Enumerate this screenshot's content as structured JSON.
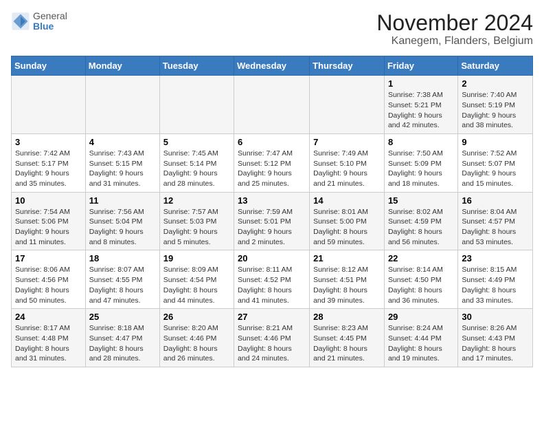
{
  "logo": {
    "general": "General",
    "blue": "Blue"
  },
  "title": "November 2024",
  "subtitle": "Kanegem, Flanders, Belgium",
  "weekdays": [
    "Sunday",
    "Monday",
    "Tuesday",
    "Wednesday",
    "Thursday",
    "Friday",
    "Saturday"
  ],
  "weeks": [
    [
      {
        "day": "",
        "info": ""
      },
      {
        "day": "",
        "info": ""
      },
      {
        "day": "",
        "info": ""
      },
      {
        "day": "",
        "info": ""
      },
      {
        "day": "",
        "info": ""
      },
      {
        "day": "1",
        "info": "Sunrise: 7:38 AM\nSunset: 5:21 PM\nDaylight: 9 hours and 42 minutes."
      },
      {
        "day": "2",
        "info": "Sunrise: 7:40 AM\nSunset: 5:19 PM\nDaylight: 9 hours and 38 minutes."
      }
    ],
    [
      {
        "day": "3",
        "info": "Sunrise: 7:42 AM\nSunset: 5:17 PM\nDaylight: 9 hours and 35 minutes."
      },
      {
        "day": "4",
        "info": "Sunrise: 7:43 AM\nSunset: 5:15 PM\nDaylight: 9 hours and 31 minutes."
      },
      {
        "day": "5",
        "info": "Sunrise: 7:45 AM\nSunset: 5:14 PM\nDaylight: 9 hours and 28 minutes."
      },
      {
        "day": "6",
        "info": "Sunrise: 7:47 AM\nSunset: 5:12 PM\nDaylight: 9 hours and 25 minutes."
      },
      {
        "day": "7",
        "info": "Sunrise: 7:49 AM\nSunset: 5:10 PM\nDaylight: 9 hours and 21 minutes."
      },
      {
        "day": "8",
        "info": "Sunrise: 7:50 AM\nSunset: 5:09 PM\nDaylight: 9 hours and 18 minutes."
      },
      {
        "day": "9",
        "info": "Sunrise: 7:52 AM\nSunset: 5:07 PM\nDaylight: 9 hours and 15 minutes."
      }
    ],
    [
      {
        "day": "10",
        "info": "Sunrise: 7:54 AM\nSunset: 5:06 PM\nDaylight: 9 hours and 11 minutes."
      },
      {
        "day": "11",
        "info": "Sunrise: 7:56 AM\nSunset: 5:04 PM\nDaylight: 9 hours and 8 minutes."
      },
      {
        "day": "12",
        "info": "Sunrise: 7:57 AM\nSunset: 5:03 PM\nDaylight: 9 hours and 5 minutes."
      },
      {
        "day": "13",
        "info": "Sunrise: 7:59 AM\nSunset: 5:01 PM\nDaylight: 9 hours and 2 minutes."
      },
      {
        "day": "14",
        "info": "Sunrise: 8:01 AM\nSunset: 5:00 PM\nDaylight: 8 hours and 59 minutes."
      },
      {
        "day": "15",
        "info": "Sunrise: 8:02 AM\nSunset: 4:59 PM\nDaylight: 8 hours and 56 minutes."
      },
      {
        "day": "16",
        "info": "Sunrise: 8:04 AM\nSunset: 4:57 PM\nDaylight: 8 hours and 53 minutes."
      }
    ],
    [
      {
        "day": "17",
        "info": "Sunrise: 8:06 AM\nSunset: 4:56 PM\nDaylight: 8 hours and 50 minutes."
      },
      {
        "day": "18",
        "info": "Sunrise: 8:07 AM\nSunset: 4:55 PM\nDaylight: 8 hours and 47 minutes."
      },
      {
        "day": "19",
        "info": "Sunrise: 8:09 AM\nSunset: 4:54 PM\nDaylight: 8 hours and 44 minutes."
      },
      {
        "day": "20",
        "info": "Sunrise: 8:11 AM\nSunset: 4:52 PM\nDaylight: 8 hours and 41 minutes."
      },
      {
        "day": "21",
        "info": "Sunrise: 8:12 AM\nSunset: 4:51 PM\nDaylight: 8 hours and 39 minutes."
      },
      {
        "day": "22",
        "info": "Sunrise: 8:14 AM\nSunset: 4:50 PM\nDaylight: 8 hours and 36 minutes."
      },
      {
        "day": "23",
        "info": "Sunrise: 8:15 AM\nSunset: 4:49 PM\nDaylight: 8 hours and 33 minutes."
      }
    ],
    [
      {
        "day": "24",
        "info": "Sunrise: 8:17 AM\nSunset: 4:48 PM\nDaylight: 8 hours and 31 minutes."
      },
      {
        "day": "25",
        "info": "Sunrise: 8:18 AM\nSunset: 4:47 PM\nDaylight: 8 hours and 28 minutes."
      },
      {
        "day": "26",
        "info": "Sunrise: 8:20 AM\nSunset: 4:46 PM\nDaylight: 8 hours and 26 minutes."
      },
      {
        "day": "27",
        "info": "Sunrise: 8:21 AM\nSunset: 4:46 PM\nDaylight: 8 hours and 24 minutes."
      },
      {
        "day": "28",
        "info": "Sunrise: 8:23 AM\nSunset: 4:45 PM\nDaylight: 8 hours and 21 minutes."
      },
      {
        "day": "29",
        "info": "Sunrise: 8:24 AM\nSunset: 4:44 PM\nDaylight: 8 hours and 19 minutes."
      },
      {
        "day": "30",
        "info": "Sunrise: 8:26 AM\nSunset: 4:43 PM\nDaylight: 8 hours and 17 minutes."
      }
    ]
  ]
}
